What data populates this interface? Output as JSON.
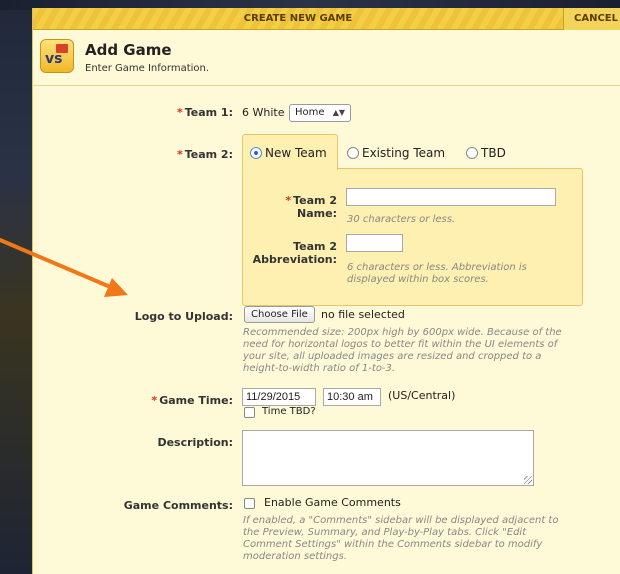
{
  "modal": {
    "title": "CREATE NEW GAME",
    "cancel_label": "CANCEL"
  },
  "header": {
    "title": "Add Game",
    "subtitle": "Enter Game Information.",
    "icon": "vs-icon"
  },
  "form": {
    "team1": {
      "label": "Team 1:",
      "value": "6 White",
      "location_select": "Home"
    },
    "team2": {
      "label": "Team 2:",
      "options": [
        "New Team",
        "Existing Team",
        "TBD"
      ],
      "selected": "New Team",
      "name_label_line1": "Team 2",
      "name_label_line2": "Name:",
      "name_value": "",
      "name_help": "30 characters or less.",
      "abbr_label_line1": "Team 2",
      "abbr_label_line2": "Abbreviation:",
      "abbr_value": "",
      "abbr_help_line1": "6 characters or less. Abbreviation is",
      "abbr_help_line2": "displayed within box scores."
    },
    "logo": {
      "label": "Logo to Upload:",
      "button_label": "Choose File",
      "status": "no file selected",
      "help_lines": [
        "Recommended size: 200px high by 600px wide. Because of the",
        "need for horizontal logos to better fit within the UI elements of",
        "your site, all uploaded images are resized and cropped to a",
        "height-to-width ratio of 1-to-3."
      ]
    },
    "game_time": {
      "label": "Game Time:",
      "date": "11/29/2015",
      "time": "10:30 am",
      "timezone": "(US/Central)",
      "tbd_label": "Time TBD?"
    },
    "description": {
      "label": "Description:",
      "value": ""
    },
    "comments": {
      "label": "Game Comments:",
      "checkbox_label": "Enable Game Comments",
      "help_lines": [
        "If enabled, a \"Comments\" sidebar will be displayed adjacent to",
        "the Preview, Summary, and Play-by-Play tabs. Click \"Edit",
        "Comment Settings\" within the Comments sidebar to modify",
        "moderation settings."
      ]
    }
  },
  "colors": {
    "background": "#fef9d6",
    "header": "#f2cf44",
    "required": "#d8331a",
    "annotation_arrow": "#f07818"
  }
}
